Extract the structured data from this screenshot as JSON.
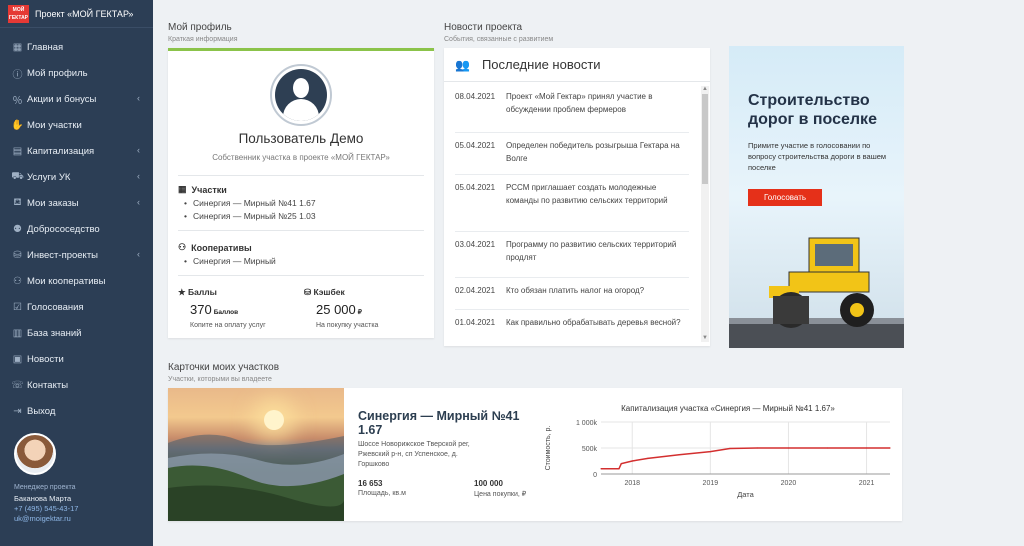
{
  "app": {
    "logo_text": "МОЙ ГЕКТАР",
    "title": "Проект «МОЙ ГЕКТАР»"
  },
  "sidebar": {
    "items": [
      {
        "label": "Главная",
        "icon": "grid-icon",
        "has_submenu": false
      },
      {
        "label": "Мой профиль",
        "icon": "info-icon",
        "has_submenu": false
      },
      {
        "label": "Акции и бонусы",
        "icon": "percent-icon",
        "has_submenu": true
      },
      {
        "label": "Мои участки",
        "icon": "handshake-icon",
        "has_submenu": false
      },
      {
        "label": "Капитализация",
        "icon": "chart-icon",
        "has_submenu": true
      },
      {
        "label": "Услуги УК",
        "icon": "truck-icon",
        "has_submenu": true
      },
      {
        "label": "Мои заказы",
        "icon": "cart-icon",
        "has_submenu": true
      },
      {
        "label": "Добрососедство",
        "icon": "people-icon",
        "has_submenu": false
      },
      {
        "label": "Инвест-проекты",
        "icon": "coins-icon",
        "has_submenu": true
      },
      {
        "label": "Мои кооперативы",
        "icon": "group-icon",
        "has_submenu": false
      },
      {
        "label": "Голосования",
        "icon": "check-icon",
        "has_submenu": false
      },
      {
        "label": "База знаний",
        "icon": "book-icon",
        "has_submenu": false
      },
      {
        "label": "Новости",
        "icon": "news-icon",
        "has_submenu": false
      },
      {
        "label": "Контакты",
        "icon": "phone-icon",
        "has_submenu": false
      },
      {
        "label": "Выход",
        "icon": "exit-icon",
        "has_submenu": false
      }
    ],
    "manager": {
      "label": "Менеджер проекта",
      "name": "Баканова Марта",
      "phone": "+7 (495) 545-43-17",
      "email": "uk@moigektar.ru"
    }
  },
  "profile_section": {
    "title": "Мой профиль",
    "subtitle": "Краткая информация",
    "user_name": "Пользователь Демо",
    "user_role": "Собственник участка в проекте «МОЙ ГЕКТАР»",
    "plots_heading": "Участки",
    "plots": [
      "Синергия — Мирный №41 1.67",
      "Синергия — Мирный №25 1.03"
    ],
    "coops_heading": "Кооперативы",
    "coops": [
      "Синергия — Мирный"
    ],
    "points_heading": "Баллы",
    "points_value": "370",
    "points_unit": "Баллов",
    "points_note": "Копите на оплату услуг",
    "cashback_heading": "Кэшбек",
    "cashback_value": "25 000",
    "cashback_unit": "₽",
    "cashback_note": "На покупку участка"
  },
  "news_section": {
    "title": "Новости проекта",
    "subtitle": "События, связанные с развитием",
    "card_title": "Последние новости",
    "items": [
      {
        "date": "08.04.2021",
        "text": "Проект «Мой Гектар» принял участие в обсуждении проблем фермеров"
      },
      {
        "date": "05.04.2021",
        "text": "Определен победитель розыгрыша Гектара на Волге"
      },
      {
        "date": "05.04.2021",
        "text": "РССМ приглашает создать молодежные команды по развитию сельских территорий"
      },
      {
        "date": "03.04.2021",
        "text": "Программу по развитию сельских территорий продлят"
      },
      {
        "date": "02.04.2021",
        "text": "Кто обязан платить налог на огород?"
      },
      {
        "date": "01.04.2021",
        "text": "Как правильно обрабатывать деревья весной?"
      }
    ]
  },
  "banner": {
    "title": "Строительство дорог в поселке",
    "text": "Примите участие  в голосовании по вопросу строительства дороги в вашем поселке",
    "button": "Голосовать"
  },
  "lots_section": {
    "title": "Карточки моих участков",
    "subtitle": "Участки, которыми вы владеете",
    "lot_title": "Синергия — Мирный №41 1.67",
    "lot_address": "Шоссе Новорижское Тверской рег, Ржевский р-н, сп Успенское, д. Горшково",
    "area_value": "16 653",
    "area_label": "Площадь, кв.м",
    "price_value": "100 000",
    "price_label": "Цена покупки, ₽"
  },
  "chart_data": {
    "type": "line",
    "title": "Капитализация участка «Синергия — Мирный №41 1.67»",
    "xlabel": "Дата",
    "ylabel": "Стоимость, р.",
    "x_ticks": [
      "2018",
      "2019",
      "2020",
      "2021"
    ],
    "y_ticks": [
      "0",
      "500k",
      "1 000k"
    ],
    "ylim": [
      0,
      1000000
    ],
    "xlim": [
      2017.6,
      2021.3
    ],
    "grid": true,
    "color": "#d32f2f",
    "series": [
      {
        "x": [
          2017.6,
          2017.83,
          2017.86,
          2018.0,
          2018.2,
          2018.6,
          2019.0,
          2019.25,
          2019.6,
          2020.0,
          2020.5,
          2021.0,
          2021.3
        ],
        "values": [
          100000,
          100000,
          200000,
          250000,
          300000,
          370000,
          430000,
          490000,
          500000,
          500000,
          500000,
          500000,
          500000
        ]
      }
    ]
  }
}
